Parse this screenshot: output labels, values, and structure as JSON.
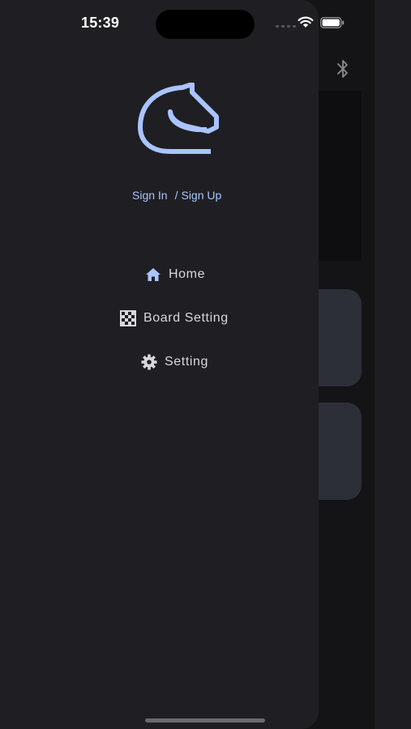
{
  "status_bar": {
    "time": "15:39"
  },
  "auth": {
    "sign_in": "Sign In",
    "separator": "/",
    "sign_up": "Sign Up"
  },
  "menu": {
    "items": [
      {
        "label": "Home",
        "icon": "home-icon"
      },
      {
        "label": "Board Setting",
        "icon": "checkerboard-icon"
      },
      {
        "label": "Setting",
        "icon": "gear-icon"
      }
    ]
  },
  "colors": {
    "accent": "#a9c4ff",
    "drawer_bg": "#1f1f23",
    "text": "#d8d8dc"
  }
}
